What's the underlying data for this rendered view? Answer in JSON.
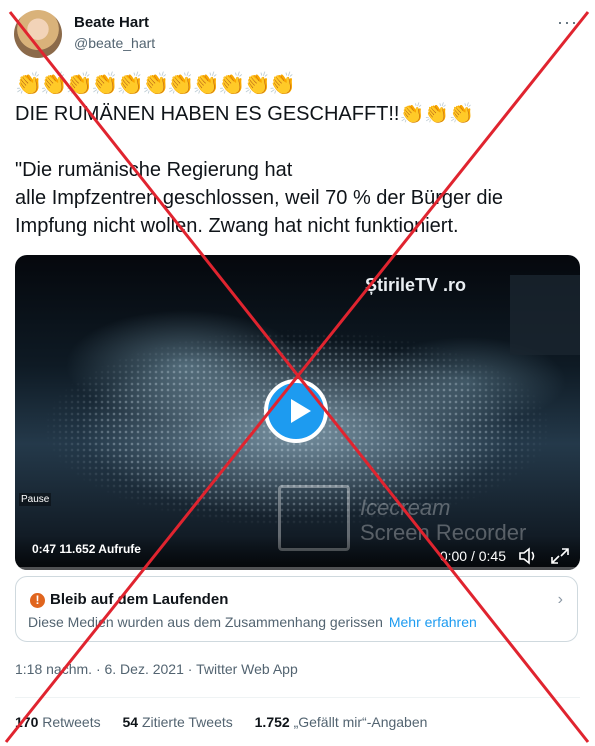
{
  "author": {
    "name": "Beate Hart",
    "handle": "@beate_hart"
  },
  "menu_icon": "more-horizontal-icon",
  "tweet": {
    "claps": "👏👏👏👏👏👏👏👏👏👏👏",
    "headline": "DIE RUMÄNEN HABEN ES GESCHAFFT!!👏👏👏",
    "body_line1": "\"Die rumänische Regierung hat",
    "body_line2": "alle Impfzentren geschlossen, weil 70 % der Bürger die",
    "body_line3": "Impfung nicht wollen. Zwang hat nicht funktioniert."
  },
  "video": {
    "overlay_logo": "ȘtirileTV .ro",
    "pause_label": "Pause",
    "watermark_text": "Icecream",
    "watermark_sub": "Screen Recorder",
    "views_overlay": "0:47  11.652 Aufrufe",
    "time": "0:00 / 0:45",
    "progress": 0.0,
    "icons": [
      "play-icon",
      "volume-icon",
      "expand-icon"
    ]
  },
  "notice": {
    "title": "Bleib auf dem Laufenden",
    "body": "Diese Medien wurden aus dem Zusammenhang gerissen",
    "link": "Mehr erfahren",
    "accent": "#e0651e"
  },
  "meta": "1:18 nachm. · 6. Dez. 2021 · Twitter Web App",
  "stats": {
    "retweets_count": "170",
    "retweets_label": "Retweets",
    "quotes_count": "54",
    "quotes_label": "Zitierte Tweets",
    "likes_count": "1.752",
    "likes_label": "„Gefällt mir“-Angaben"
  },
  "colors": {
    "accent": "#1d9bf0",
    "cross": "#e0242f",
    "text": "#0f1419",
    "muted": "#536471"
  }
}
